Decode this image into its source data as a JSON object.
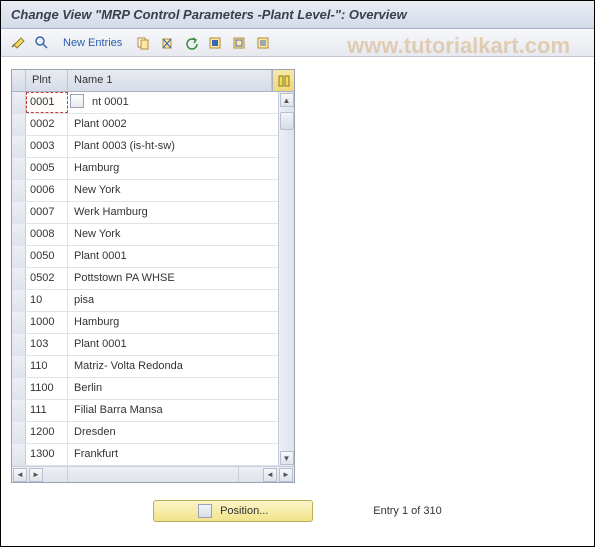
{
  "title": "Change View \"MRP Control Parameters -Plant Level-\": Overview",
  "watermark": "www.tutorialkart.com",
  "toolbar": {
    "new_entries": "New Entries"
  },
  "table": {
    "col_plnt": "Plnt",
    "col_name": "Name 1",
    "rows": [
      {
        "plnt": "0001",
        "name": "nt 0001",
        "selected": true,
        "f4": true
      },
      {
        "plnt": "0002",
        "name": "Plant 0002"
      },
      {
        "plnt": "0003",
        "name": "Plant 0003 (is-ht-sw)"
      },
      {
        "plnt": "0005",
        "name": "Hamburg"
      },
      {
        "plnt": "0006",
        "name": "New York"
      },
      {
        "plnt": "0007",
        "name": "Werk Hamburg"
      },
      {
        "plnt": "0008",
        "name": "New York"
      },
      {
        "plnt": "0050",
        "name": "Plant 0001"
      },
      {
        "plnt": "0502",
        "name": "Pottstown PA WHSE"
      },
      {
        "plnt": "10",
        "name": "pisa"
      },
      {
        "plnt": "1000",
        "name": "Hamburg"
      },
      {
        "plnt": "103",
        "name": "Plant 0001"
      },
      {
        "plnt": "110",
        "name": "Matriz- Volta Redonda"
      },
      {
        "plnt": "1100",
        "name": "Berlin"
      },
      {
        "plnt": "111",
        "name": "Filial Barra Mansa"
      },
      {
        "plnt": "1200",
        "name": "Dresden"
      },
      {
        "plnt": "1300",
        "name": "Frankfurt"
      }
    ]
  },
  "footer": {
    "position_label": "Position...",
    "entry_label": "Entry 1 of 310"
  }
}
